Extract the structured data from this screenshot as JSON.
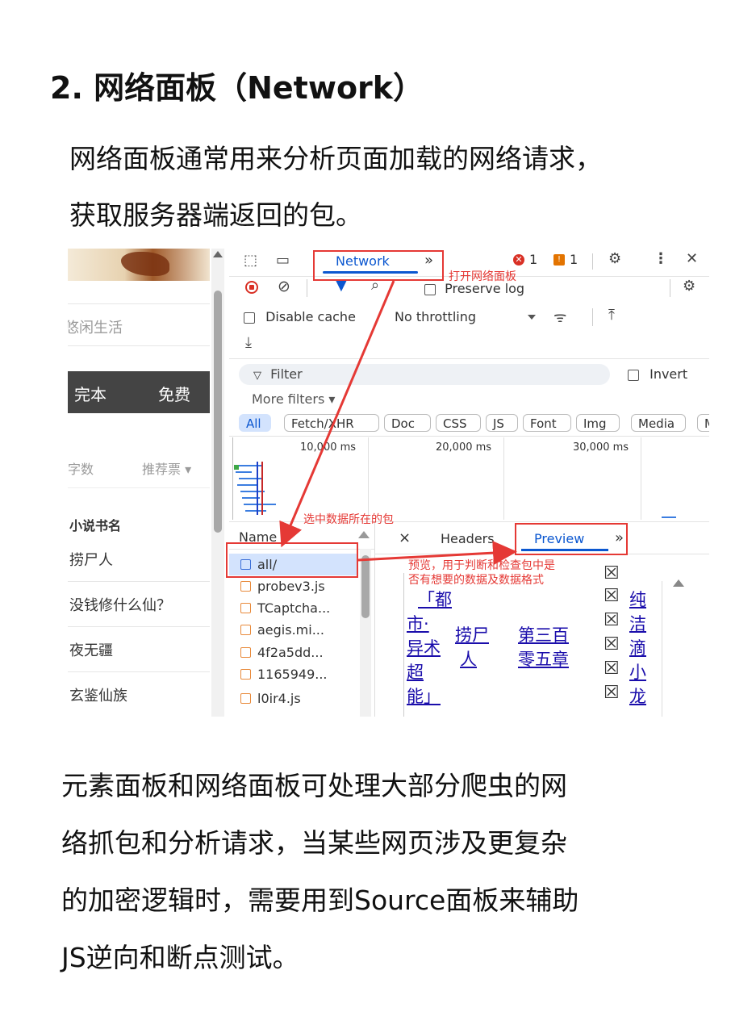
{
  "heading": "2. 网络面板（Network）",
  "intro": {
    "line1": "网络面板通常用来分析页面加载的网络请求，",
    "line2": "获取服务器端返回的包。"
  },
  "site": {
    "tagline": "悠闲生活",
    "nav": [
      "完本",
      "免费"
    ],
    "sort": {
      "words": "字数",
      "recommend": "推荐票 ▾"
    },
    "list_header": "小说书名",
    "books": [
      "捞尸人",
      "没钱修什么仙？",
      "夜无疆",
      "玄鉴仙族"
    ]
  },
  "devtools": {
    "tab_network": "Network",
    "more_tabs": "»",
    "errors": "1",
    "warnings": "1",
    "preserve_log": "Preserve log",
    "disable_cache": "Disable cache",
    "throttling": "No throttling",
    "filter_placeholder": "Filter",
    "invert": "Invert",
    "more_filters": "More filters ▾",
    "chips": [
      "All",
      "Fetch/XHR",
      "Doc",
      "CSS",
      "JS",
      "Font",
      "Img",
      "Media",
      "M"
    ],
    "timeline_ticks": [
      "10,000 ms",
      "20,000 ms",
      "30,000 ms"
    ],
    "name_header": "Name",
    "requests": [
      "all/",
      "probev3.js",
      "TCaptcha...",
      "aegis.mi...",
      "4f2a5dd...",
      "1165949...",
      "l0ir4.js"
    ],
    "detail_tabs": {
      "close": "×",
      "headers": "Headers",
      "preview": "Preview",
      "more": "»"
    },
    "preview": {
      "col1": [
        "「都",
        "市·",
        "异术",
        "超",
        "能」"
      ],
      "col2": [
        "捞尸",
        "人"
      ],
      "col3": [
        "第三百",
        "零五章"
      ],
      "col4": [
        "纯",
        "洁",
        "滴",
        "小",
        "龙"
      ]
    }
  },
  "annotations": {
    "open_network": "打开网络面板",
    "select_package": "选中数据所在的包",
    "preview_note_1": "预览，用于判断和检查包中是",
    "preview_note_2": "否有想要的数据及数据格式"
  },
  "outro": {
    "line1": "元素面板和网络面板可处理大部分爬虫的网",
    "line2": "络抓包和分析请求，当某些网页涉及更复杂",
    "line3": "的加密逻辑时，需要用到Source面板来辅助",
    "line4": "JS逆向和断点测试。"
  },
  "colors": {
    "annotation_red": "#e53935",
    "devtools_blue": "#0b57d0",
    "link_blue": "#1a0dab"
  }
}
